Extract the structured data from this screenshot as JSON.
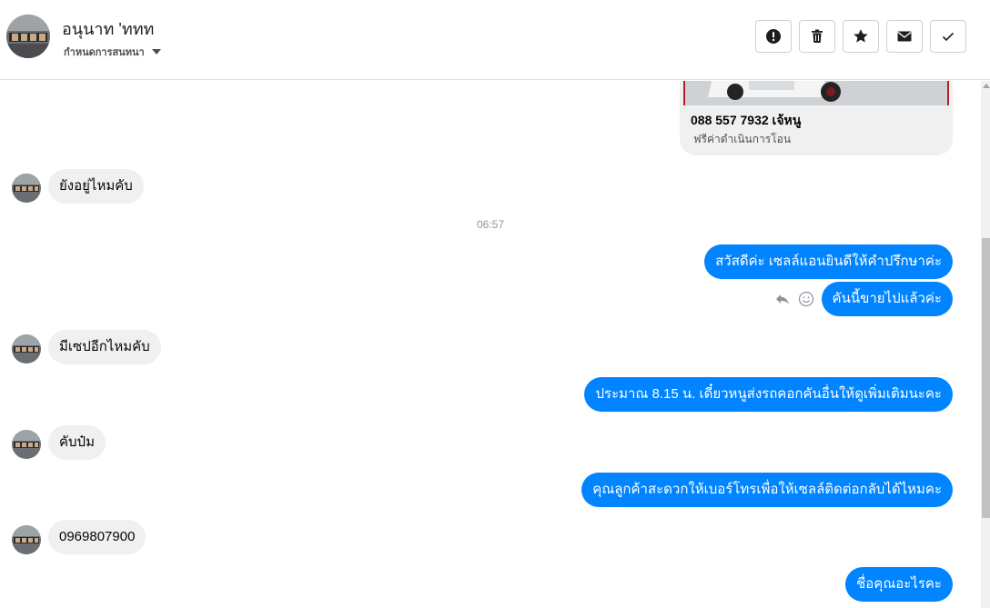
{
  "header": {
    "contact_name": "อนุนาท 'ททท",
    "status_label": "กำหนดการสนทนา",
    "actions": [
      {
        "name": "report-button",
        "icon": "alert-icon"
      },
      {
        "name": "delete-button",
        "icon": "trash-icon"
      },
      {
        "name": "star-button",
        "icon": "star-icon"
      },
      {
        "name": "mark-unread-button",
        "icon": "envelope-icon"
      },
      {
        "name": "mark-done-button",
        "icon": "check-icon"
      }
    ]
  },
  "card": {
    "title": "088 557 7932 เจ้หนู",
    "subtitle": "ฟรีค่าดำเนินการโอน"
  },
  "messages": [
    {
      "from": "in",
      "text": "ยังอยู่ไหมคับ"
    },
    {
      "type": "time",
      "text": "06:57"
    },
    {
      "from": "out",
      "text": "สวัสดีค่ะ เซลล์แอนยินดีให้คำปรึกษาค่ะ"
    },
    {
      "from": "out",
      "text": "คันนี้ขายไปแล้วค่ะ"
    },
    {
      "from": "in",
      "text": "มีเซปอีกไหมคับ"
    },
    {
      "from": "out",
      "text": "ประมาณ 8.15 น. เดี๋ยวหนูส่งรถคอกคันอื่นให้ดูเพิ่มเติมนะคะ"
    },
    {
      "from": "in",
      "text": "คับป๋ม"
    },
    {
      "from": "out",
      "text": "คุณลูกค้าสะดวกให้เบอร์โทรเพื่อให้เซลล์ติดต่อกลับได้ไหมคะ"
    },
    {
      "from": "in",
      "text": "0969807900"
    },
    {
      "from": "out",
      "text": "ชื่อคุณอะไรคะ"
    }
  ],
  "colors": {
    "outgoing_bubble": "#0084ff",
    "incoming_bubble": "#f0f0f0"
  }
}
